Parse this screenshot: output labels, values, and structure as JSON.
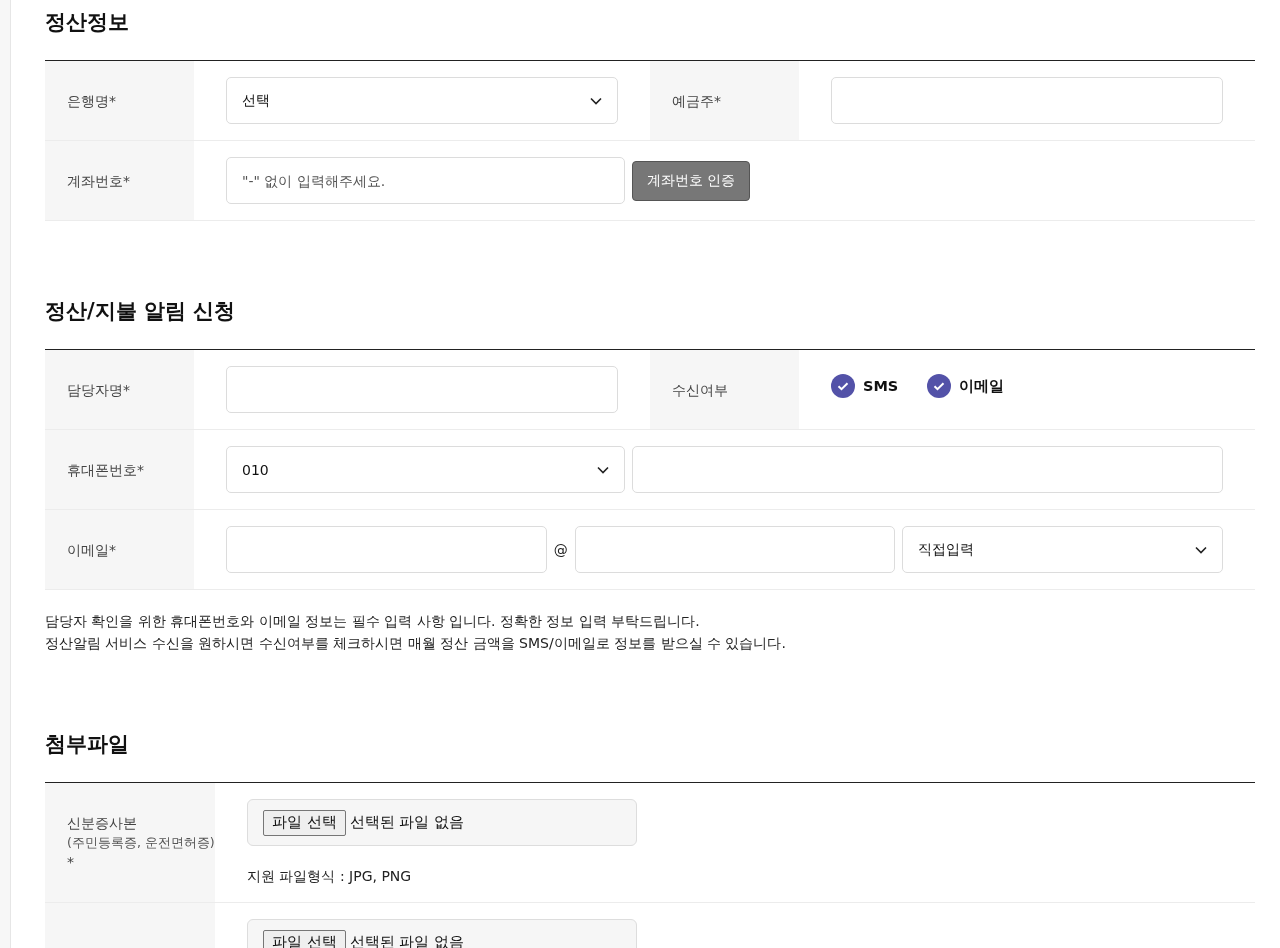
{
  "sections": [
    {
      "title": "정산정보",
      "rows": [
        {
          "cells": [
            {
              "label": "은행명*",
              "fields": [
                {
                  "kind": "select",
                  "value": "선택"
                }
              ]
            },
            {
              "label": "예금주*",
              "fields": [
                {
                  "kind": "input"
                }
              ]
            }
          ]
        },
        {
          "cells": [
            {
              "label": "계좌번호*",
              "fields": [
                {
                  "kind": "input",
                  "placeholder": "\"-\" 없이 입력해주세요."
                },
                {
                  "kind": "button",
                  "label": "계좌번호 인증"
                }
              ]
            }
          ]
        }
      ]
    },
    {
      "title": "정산/지불 알림 신청",
      "rows": [
        {
          "cells": [
            {
              "label": "담당자명*",
              "fields": [
                {
                  "kind": "input"
                }
              ]
            },
            {
              "label": "수신여부",
              "fields": [
                {
                  "kind": "checkbox",
                  "label": "SMS",
                  "checked": true
                },
                {
                  "kind": "checkbox",
                  "label": "이메일",
                  "checked": true
                }
              ]
            }
          ]
        },
        {
          "cells": [
            {
              "label": "휴대폰번호*",
              "fields": [
                {
                  "kind": "select",
                  "value": "010"
                },
                {
                  "kind": "input"
                }
              ]
            }
          ]
        },
        {
          "cells": [
            {
              "label": "이메일*",
              "fields": [
                {
                  "kind": "input"
                },
                {
                  "kind": "separator",
                  "text": "@"
                },
                {
                  "kind": "input"
                },
                {
                  "kind": "select",
                  "value": "직접입력"
                }
              ]
            }
          ]
        }
      ],
      "notes": [
        "담당자 확인을 위한 휴대폰번호와 이메일 정보는 필수 입력 사항 입니다. 정확한 정보 입력 부탁드립니다.",
        "정산알림 서비스 수신을 원하시면 수신여부를 체크하시면 매월 정산 금액을 SMS/이메일로 정보를 받으실 수 있습니다."
      ]
    },
    {
      "title": "첨부파일",
      "rows": [
        {
          "cells": [
            {
              "label": "신분증사본",
              "sublabel": "(주민등록증, 운전면허증)",
              "required_mark": "*",
              "fields": [
                {
                  "kind": "file",
                  "button": "파일 선택",
                  "status": "선택된 파일 없음",
                  "hint": "지원 파일형식 : JPG, PNG"
                }
              ]
            }
          ]
        },
        {
          "cells": [
            {
              "fields": [
                {
                  "kind": "file",
                  "button": "파일 선택",
                  "status": "선택된 파일 없음"
                }
              ]
            }
          ]
        }
      ]
    }
  ]
}
